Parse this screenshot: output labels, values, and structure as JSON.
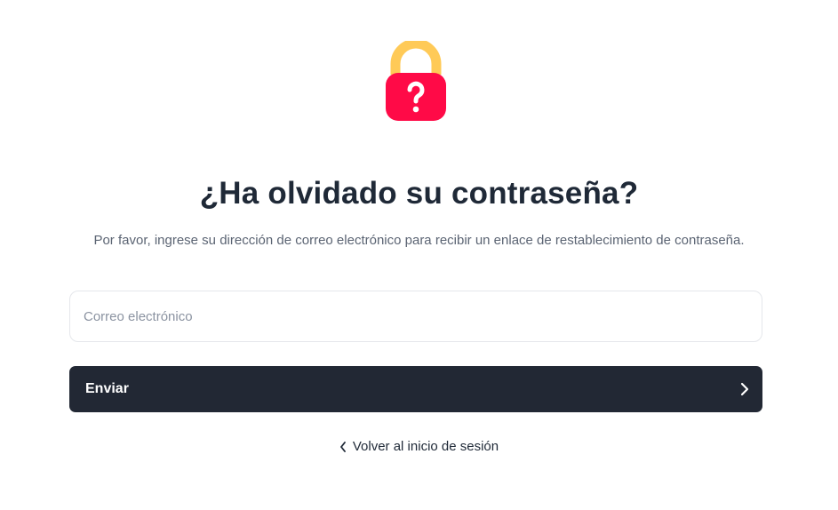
{
  "header": {
    "icon": "lock-question-icon",
    "title": "¿Ha olvidado su contraseña?",
    "subtitle": "Por favor, ingrese su dirección de correo electrónico para recibir un enlace de restablecimiento de contraseña."
  },
  "form": {
    "email": {
      "value": "",
      "placeholder": "Correo electrónico"
    },
    "submit_label": "Enviar",
    "submit_icon": "chevron-right-icon"
  },
  "footer": {
    "back_label": "Volver al inicio de sesión",
    "back_icon": "chevron-left-icon"
  },
  "colors": {
    "lock_shackle": "#FFCA57",
    "lock_body": "#FF0A47",
    "button_bg": "#222834",
    "title_text": "#1F2937",
    "subtitle_text": "#5B6473"
  }
}
